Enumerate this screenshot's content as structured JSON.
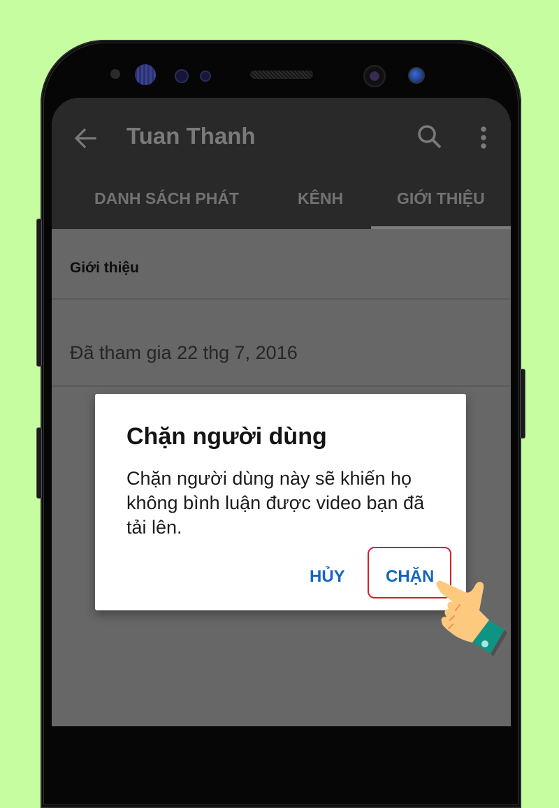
{
  "app": {
    "title": "Tuan Thanh",
    "back_icon": "arrow-left-icon",
    "search_icon": "search-icon",
    "more_icon": "more-vertical-icon"
  },
  "tabs": [
    {
      "label": "DANH SÁCH PHÁT",
      "active": false
    },
    {
      "label": "KÊNH",
      "active": false
    },
    {
      "label": "GIỚI THIỆU",
      "active": true
    }
  ],
  "about": {
    "section_title": "Giới thiệu",
    "joined": "Đã tham gia 22 thg 7, 2016"
  },
  "dialog": {
    "title": "Chặn người dùng",
    "message": "Chặn người dùng này sẽ khiến họ không bình luận được video bạn đã tải lên.",
    "cancel_label": "HỦY",
    "confirm_label": "CHẶN",
    "accent_color": "#1565c0",
    "highlight_color": "#d3202a"
  },
  "annotation": {
    "pointer_icon": "pointing-hand-icon"
  }
}
